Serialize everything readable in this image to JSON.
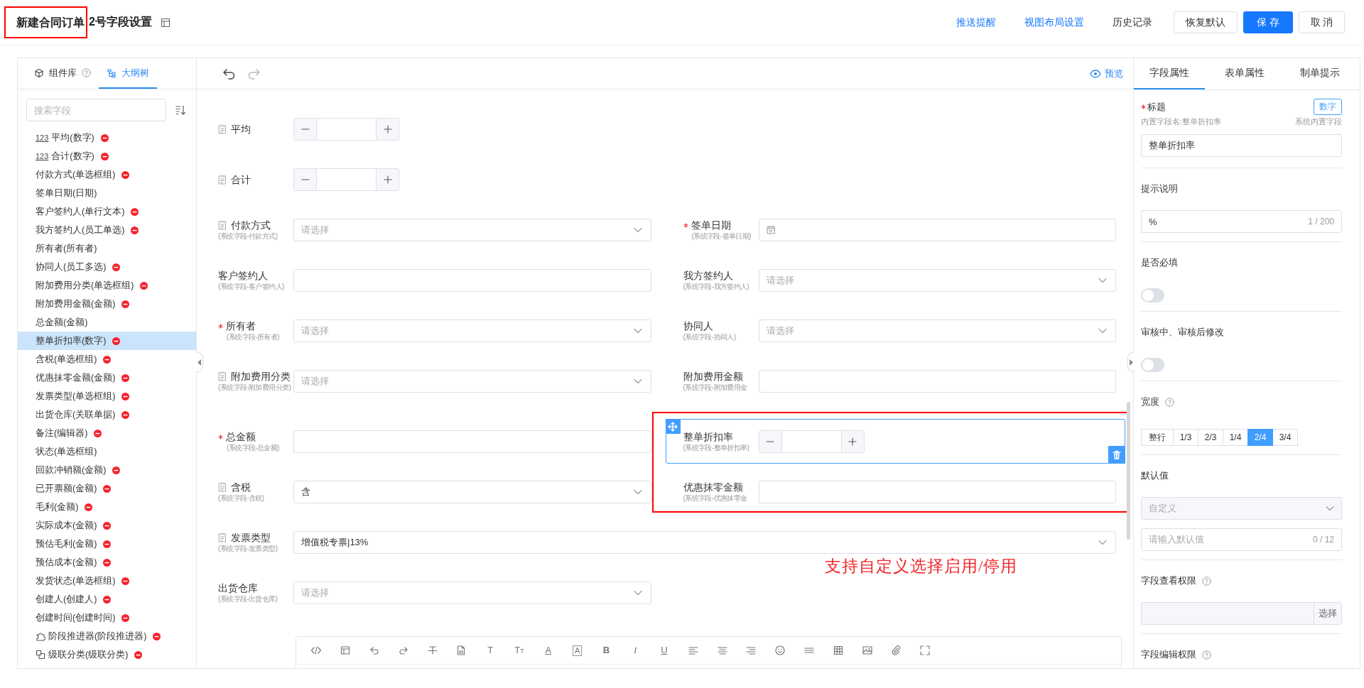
{
  "header": {
    "title": "新建合同订单",
    "title_highlighted": true,
    "subtitle": "2号字段设置",
    "links": [
      {
        "label": "推送提醒",
        "kind": "link"
      },
      {
        "label": "视图布局设置",
        "kind": "link"
      },
      {
        "label": "历史记录",
        "kind": "plain"
      }
    ],
    "buttons": [
      {
        "label": "恢复默认",
        "kind": "default"
      },
      {
        "label": "保存",
        "kind": "primary"
      },
      {
        "label": "取消",
        "kind": "default"
      }
    ]
  },
  "sidebar": {
    "tabs": [
      {
        "label": "组件库",
        "kind": "library",
        "help": true,
        "selected": false
      },
      {
        "label": "大纲树",
        "kind": "tree",
        "help": false,
        "selected": true
      }
    ],
    "search": {
      "placeholder": "搜索字段"
    },
    "items": [
      {
        "label": "平均(数字)",
        "kind": "number",
        "prefix": "123",
        "removable": true,
        "selected": false
      },
      {
        "label": "合计(数字)",
        "kind": "number",
        "prefix": "123",
        "removable": true,
        "selected": false
      },
      {
        "label": "付款方式(单选框组)",
        "kind": "plain",
        "removable": true,
        "selected": false
      },
      {
        "label": "签单日期(日期)",
        "kind": "plain",
        "removable": false,
        "selected": false
      },
      {
        "label": "客户签约人(单行文本)",
        "kind": "plain",
        "removable": true,
        "selected": false
      },
      {
        "label": "我方签约人(员工单选)",
        "kind": "plain",
        "removable": true,
        "selected": false
      },
      {
        "label": "所有者(所有者)",
        "kind": "plain",
        "removable": false,
        "selected": false
      },
      {
        "label": "协同人(员工多选)",
        "kind": "plain",
        "removable": true,
        "selected": false
      },
      {
        "label": "附加费用分类(单选框组)",
        "kind": "plain",
        "removable": true,
        "selected": false
      },
      {
        "label": "附加费用金额(金额)",
        "kind": "plain",
        "removable": true,
        "selected": false
      },
      {
        "label": "总金额(金额)",
        "kind": "plain",
        "removable": false,
        "selected": false
      },
      {
        "label": "整单折扣率(数字)",
        "kind": "plain",
        "removable": true,
        "selected": true
      },
      {
        "label": "含税(单选框组)",
        "kind": "plain",
        "removable": true,
        "selected": false
      },
      {
        "label": "优惠抹零金额(金额)",
        "kind": "plain",
        "removable": true,
        "selected": false
      },
      {
        "label": "发票类型(单选框组)",
        "kind": "plain",
        "removable": true,
        "selected": false
      },
      {
        "label": "出货仓库(关联单据)",
        "kind": "plain",
        "removable": true,
        "selected": false
      },
      {
        "label": "备注(编辑器)",
        "kind": "plain",
        "removable": true,
        "selected": false
      },
      {
        "label": "状态(单选框组)",
        "kind": "plain",
        "removable": false,
        "selected": false
      },
      {
        "label": "回款冲销额(金额)",
        "kind": "plain",
        "removable": true,
        "selected": false
      },
      {
        "label": "已开票额(金额)",
        "kind": "plain",
        "removable": true,
        "selected": false
      },
      {
        "label": "毛利(金额)",
        "kind": "plain",
        "removable": true,
        "selected": false
      },
      {
        "label": "实际成本(金额)",
        "kind": "plain",
        "removable": true,
        "selected": false
      },
      {
        "label": "预估毛利(金额)",
        "kind": "plain",
        "removable": true,
        "selected": false
      },
      {
        "label": "预估成本(金额)",
        "kind": "plain",
        "removable": true,
        "selected": false
      },
      {
        "label": "发货状态(单选框组)",
        "kind": "plain",
        "removable": true,
        "selected": false
      },
      {
        "label": "创建人(创建人)",
        "kind": "plain",
        "removable": true,
        "selected": false
      },
      {
        "label": "创建时间(创建时间)",
        "kind": "plain",
        "removable": true,
        "selected": false
      },
      {
        "label": "阶段推进器(阶段推进器)",
        "kind": "stage",
        "removable": true,
        "selected": false
      },
      {
        "label": "级联分类(级联分类)",
        "kind": "cascade",
        "removable": true,
        "selected": false
      }
    ]
  },
  "canvas": {
    "preview": "预览",
    "rows": [
      {
        "fields": [
          {
            "label": "平均",
            "doc_icon": true,
            "required": false,
            "selected": false,
            "full_width": false,
            "control": {
              "kind": "stepper"
            }
          }
        ]
      },
      {
        "fields": [
          {
            "label": "合计",
            "doc_icon": true,
            "required": false,
            "selected": false,
            "full_width": false,
            "control": {
              "kind": "stepper"
            }
          }
        ]
      },
      {
        "fields": [
          {
            "label": "付款方式",
            "sublabel": "(系统字段-付款方式)",
            "doc_icon": true,
            "required": false,
            "selected": false,
            "full_width": false,
            "control": {
              "kind": "select",
              "placeholder": "请选择"
            }
          },
          {
            "label": "签单日期",
            "sublabel": "(系统字段-签单日期)",
            "doc_icon": false,
            "required": true,
            "selected": false,
            "full_width": false,
            "control": {
              "kind": "date"
            }
          }
        ]
      },
      {
        "fields": [
          {
            "label": "客户签约人",
            "sublabel": "(系统字段-客户签约人)",
            "doc_icon": false,
            "required": false,
            "selected": false,
            "full_width": false,
            "control": {
              "kind": "text"
            }
          },
          {
            "label": "我方签约人",
            "sublabel": "(系统字段-我方签约人)",
            "doc_icon": false,
            "required": false,
            "selected": false,
            "full_width": false,
            "control": {
              "kind": "select",
              "placeholder": "请选择"
            }
          }
        ]
      },
      {
        "fields": [
          {
            "label": "所有者",
            "sublabel": "(系统字段-所有者)",
            "doc_icon": false,
            "required": true,
            "selected": false,
            "full_width": false,
            "control": {
              "kind": "select",
              "placeholder": "请选择"
            }
          },
          {
            "label": "协同人",
            "sublabel": "(系统字段-协同人)",
            "doc_icon": false,
            "required": false,
            "selected": false,
            "full_width": false,
            "control": {
              "kind": "select",
              "placeholder": "请选择"
            }
          }
        ]
      },
      {
        "fields": [
          {
            "label": "附加费用分类",
            "sublabel": "(系统字段-附加费用分类)",
            "doc_icon": true,
            "required": false,
            "selected": false,
            "full_width": false,
            "control": {
              "kind": "select",
              "placeholder": "请选择"
            }
          },
          {
            "label": "附加费用金额",
            "sublabel": "(系统字段-附加费用金",
            "doc_icon": false,
            "required": false,
            "selected": false,
            "full_width": false,
            "control": {
              "kind": "text"
            }
          }
        ]
      },
      {
        "fields": [
          {
            "label": "总金额",
            "sublabel": "(系统字段-总金额)",
            "doc_icon": false,
            "required": true,
            "selected": false,
            "full_width": false,
            "control": {
              "kind": "text"
            }
          },
          {
            "label": "整单折扣率",
            "sublabel": "(系统字段-整单折扣率)",
            "doc_icon": false,
            "required": false,
            "selected": true,
            "full_width": false,
            "control": {
              "kind": "stepper"
            }
          }
        ]
      },
      {
        "fields": [
          {
            "label": "含税",
            "sublabel": "(系统字段-含税)",
            "doc_icon": true,
            "required": false,
            "selected": false,
            "full_width": false,
            "control": {
              "kind": "select",
              "value": "含"
            }
          },
          {
            "label": "优惠抹零金额",
            "sublabel": "(系统字段-优惠抹零金",
            "doc_icon": false,
            "required": false,
            "selected": false,
            "full_width": false,
            "control": {
              "kind": "text"
            }
          }
        ]
      },
      {
        "fields": [
          {
            "label": "发票类型",
            "sublabel": "(系统字段-发票类型)",
            "doc_icon": true,
            "required": false,
            "selected": false,
            "full_width": true,
            "control": {
              "kind": "select",
              "value": "增值税专票|13%"
            }
          }
        ]
      },
      {
        "fields": [
          {
            "label": "出货仓库",
            "sublabel": "(系统字段-出货仓库)",
            "doc_icon": false,
            "required": false,
            "selected": false,
            "full_width": false,
            "control": {
              "kind": "select",
              "placeholder": "请选择"
            }
          }
        ]
      }
    ],
    "editor_tools": [
      {
        "kind": "code"
      },
      {
        "kind": "layout"
      },
      {
        "kind": "undo"
      },
      {
        "kind": "redo"
      },
      {
        "kind": "strike"
      },
      {
        "kind": "doc"
      },
      {
        "kind": "glyph",
        "glyph": "T"
      },
      {
        "kind": "fontsize",
        "glyph": "TT"
      },
      {
        "kind": "fontcolor",
        "glyph": "A"
      },
      {
        "kind": "bgcolor",
        "glyph": "A"
      },
      {
        "kind": "bold",
        "glyph": "B"
      },
      {
        "kind": "italic",
        "glyph": "I"
      },
      {
        "kind": "underline",
        "glyph": "U"
      },
      {
        "kind": "align-left"
      },
      {
        "kind": "align-center"
      },
      {
        "kind": "align-right"
      },
      {
        "kind": "emoji"
      },
      {
        "kind": "hr"
      },
      {
        "kind": "table"
      },
      {
        "kind": "image"
      },
      {
        "kind": "attach"
      },
      {
        "kind": "fullscreen"
      }
    ]
  },
  "annotation": {
    "text": "支持自定义选择启用/停用"
  },
  "properties": {
    "tabs": [
      {
        "label": "字段属性",
        "selected": true
      },
      {
        "label": "表单属性",
        "selected": false
      },
      {
        "label": "制单提示",
        "selected": false
      }
    ],
    "title_field": {
      "label": "标题",
      "required": true,
      "type_tag": "数字",
      "builtin_name": "内置字段名:整单折扣率",
      "builtin_note": "系统内置字段",
      "value": "整单折扣率"
    },
    "hint": {
      "label": "提示说明",
      "value": "%",
      "counter": "1 / 200"
    },
    "required_toggle": {
      "label": "是否必填",
      "on": false
    },
    "edit_toggle": {
      "label": "审核中、审核后修改",
      "on": false
    },
    "width": {
      "label": "宽度",
      "options": [
        {
          "label": "整行",
          "selected": false
        },
        {
          "label": "1/3",
          "selected": false
        },
        {
          "label": "2/3",
          "selected": false
        },
        {
          "label": "1/4",
          "selected": false
        },
        {
          "label": "2/4",
          "selected": true
        },
        {
          "label": "3/4",
          "selected": false
        }
      ]
    },
    "default_value": {
      "label": "默认值",
      "mode": "自定义",
      "disabled": true,
      "placeholder": "请输入默认值",
      "counter": "0 / 12"
    },
    "view_permission": {
      "label": "字段查看权限",
      "button": "选择"
    },
    "edit_permission": {
      "label": "字段编辑权限"
    }
  }
}
